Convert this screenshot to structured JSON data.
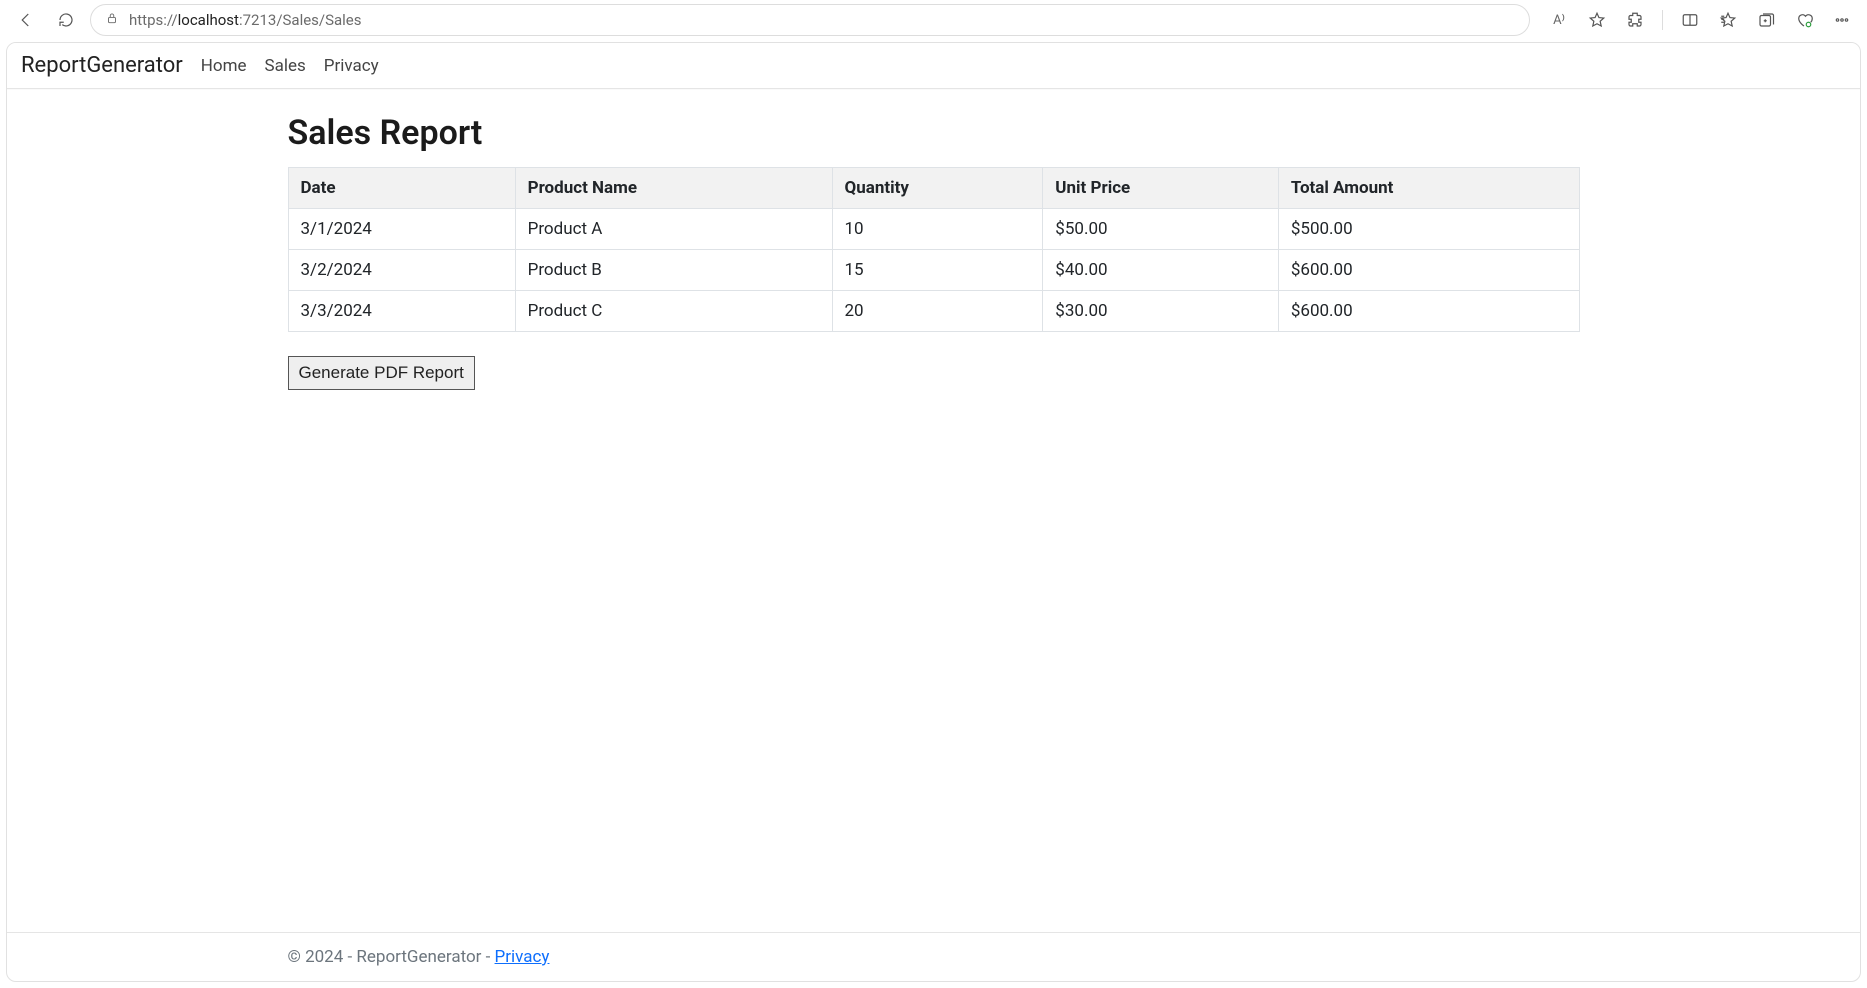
{
  "browser": {
    "url_prefix": "https://",
    "url_host": "localhost",
    "url_port": ":7213",
    "url_path": "/Sales/Sales",
    "read_aloud_label": "A⁾"
  },
  "navbar": {
    "brand": "ReportGenerator",
    "links": {
      "home": "Home",
      "sales": "Sales",
      "privacy": "Privacy"
    }
  },
  "page": {
    "title": "Sales Report",
    "generate_button": "Generate PDF Report"
  },
  "table": {
    "headers": {
      "date": "Date",
      "product_name": "Product Name",
      "quantity": "Quantity",
      "unit_price": "Unit Price",
      "total_amount": "Total Amount"
    },
    "rows": [
      {
        "date": "3/1/2024",
        "product_name": "Product A",
        "quantity": "10",
        "unit_price": "$50.00",
        "total_amount": "$500.00"
      },
      {
        "date": "3/2/2024",
        "product_name": "Product B",
        "quantity": "15",
        "unit_price": "$40.00",
        "total_amount": "$600.00"
      },
      {
        "date": "3/3/2024",
        "product_name": "Product C",
        "quantity": "20",
        "unit_price": "$30.00",
        "total_amount": "$600.00"
      }
    ]
  },
  "footer": {
    "text": "© 2024 - ReportGenerator - ",
    "privacy_link": "Privacy"
  },
  "chart_data": {
    "type": "table",
    "title": "Sales Report",
    "columns": [
      "Date",
      "Product Name",
      "Quantity",
      "Unit Price",
      "Total Amount"
    ],
    "rows": [
      [
        "3/1/2024",
        "Product A",
        10,
        50.0,
        500.0
      ],
      [
        "3/2/2024",
        "Product B",
        15,
        40.0,
        600.0
      ],
      [
        "3/3/2024",
        "Product C",
        20,
        30.0,
        600.0
      ]
    ]
  }
}
